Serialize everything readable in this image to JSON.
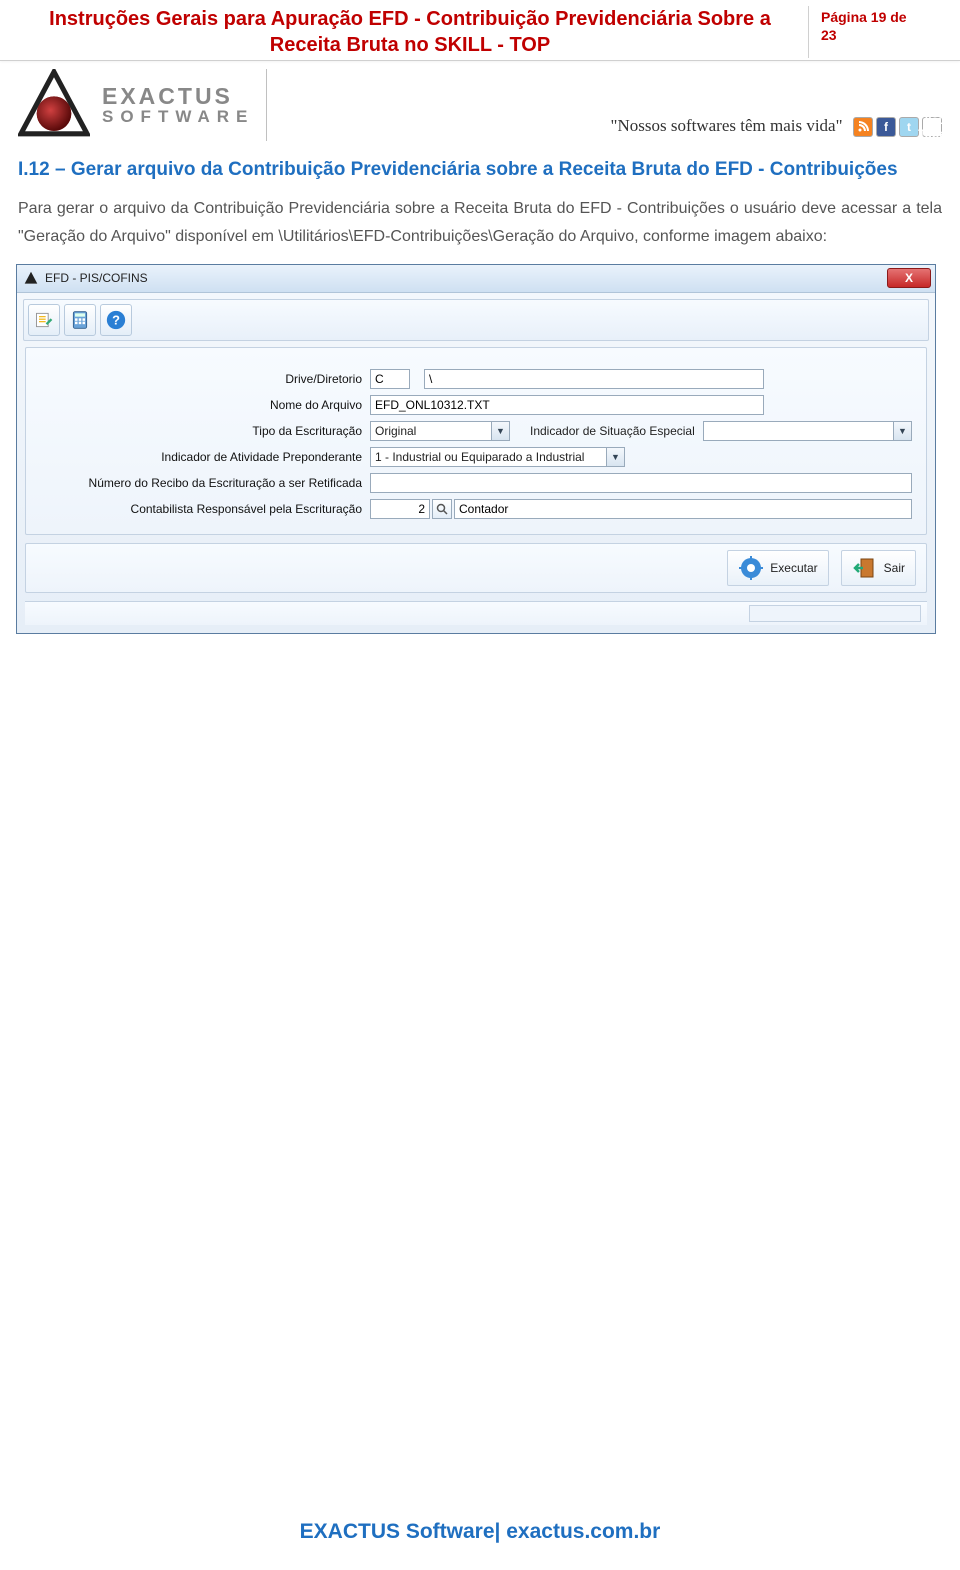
{
  "header": {
    "doc_title": "Instruções Gerais para Apuração EFD - Contribuição Previdenciária Sobre a Receita Bruta no SKILL - TOP",
    "page_label_line1": "Página 19 de",
    "page_label_line2": "23"
  },
  "brand": {
    "name_line1": "EXACTUS",
    "name_line2": "SOFTWARE",
    "slogan": "\"Nossos softwares têm mais vida\""
  },
  "social": {
    "rss": "rss-icon",
    "facebook": "facebook-icon",
    "twitter": "twitter-icon",
    "youtube": "youtube-icon"
  },
  "section": {
    "heading": "I.12 – Gerar arquivo da Contribuição Previdenciária sobre a Receita Bruta do EFD - Contribuições",
    "body": "Para gerar o arquivo da Contribuição Previdenciária sobre a Receita Bruta do EFD - Contribuições o usuário deve acessar a tela \"Geração do Arquivo\" disponível em \\Utilitários\\EFD-Contribuições\\Geração do Arquivo, conforme imagem abaixo:"
  },
  "window": {
    "title": "EFD - PIS/COFINS",
    "close": "X",
    "toolbar": {
      "btn_edit": "edit-icon",
      "btn_calc": "calculator-icon",
      "btn_help": "help-icon"
    },
    "form": {
      "labels": {
        "drive": "Drive/Diretorio",
        "filename": "Nome do Arquivo",
        "tipo": "Tipo da Escrituração",
        "situacao": "Indicador de Situação Especial",
        "atividade": "Indicador de Atividade Preponderante",
        "recibo": "Número do Recibo da Escrituração a ser Retificada",
        "contabilista": "Contabilista Responsável pela Escrituração"
      },
      "values": {
        "drive": "C",
        "path": "\\",
        "filename": "EFD_ONL10312.TXT",
        "tipo": "Original",
        "situacao": "",
        "atividade": "1 - Industrial ou Equiparado a Industrial",
        "recibo": "",
        "contabilista_code": "2",
        "contabilista_name": "Contador"
      }
    },
    "actions": {
      "execute": "Executar",
      "exit": "Sair"
    }
  },
  "footer": {
    "text": "EXACTUS Software| exactus.com.br"
  }
}
